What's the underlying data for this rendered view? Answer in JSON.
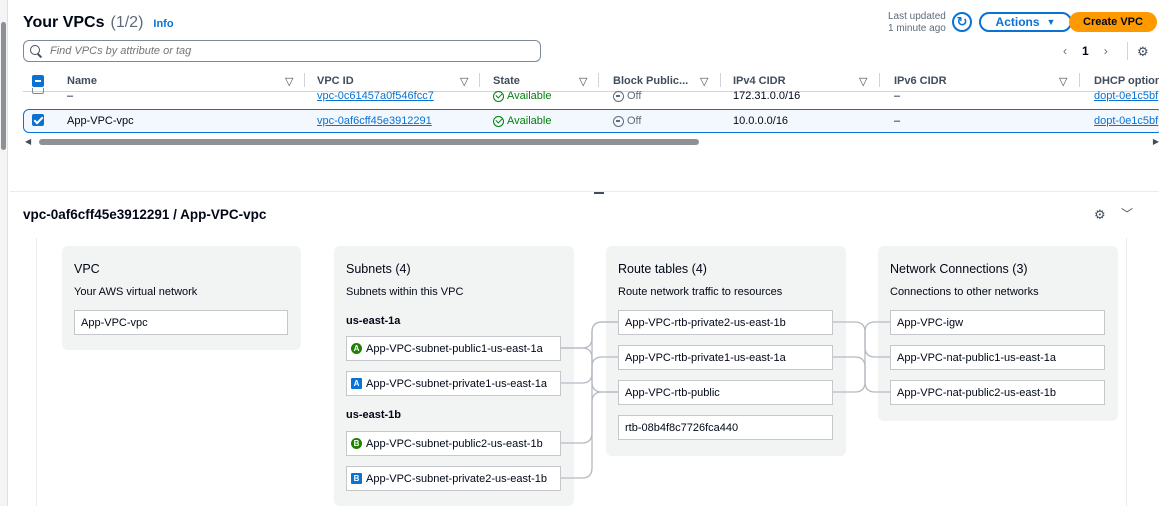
{
  "header": {
    "title": "Your VPCs",
    "count": "(1/2)",
    "info": "Info",
    "last_updated_line1": "Last updated",
    "last_updated_line2": "1 minute ago",
    "actions_label": "Actions",
    "create_label": "Create VPC"
  },
  "search": {
    "placeholder": "Find VPCs by attribute or tag"
  },
  "pagination": {
    "current_page": "1"
  },
  "table": {
    "columns": [
      "Name",
      "VPC ID",
      "State",
      "Block Public...",
      "IPv4 CIDR",
      "IPv6 CIDR",
      "DHCP option"
    ],
    "rows": [
      {
        "name": "–",
        "vpc_id": "vpc-0c61457a0f546fcc7",
        "state": "Available",
        "block_public": "Off",
        "ipv4": "172.31.0.0/16",
        "ipv6": "–",
        "dhcp": "dopt-0e1c5bf",
        "selected": false
      },
      {
        "name": "App-VPC-vpc",
        "vpc_id": "vpc-0af6cff45e3912291",
        "state": "Available",
        "block_public": "Off",
        "ipv4": "10.0.0.0/16",
        "ipv6": "–",
        "dhcp": "dopt-0e1c5bf",
        "selected": true
      }
    ]
  },
  "detail": {
    "title": "vpc-0af6cff45e3912291 / App-VPC-vpc",
    "vpc_card": {
      "title": "VPC",
      "subtitle": "Your AWS virtual network",
      "item": "App-VPC-vpc"
    },
    "subnets_card": {
      "title": "Subnets (4)",
      "subtitle": "Subnets within this VPC",
      "az1": "us-east-1a",
      "az2": "us-east-1b",
      "items": [
        {
          "badge": "A",
          "label": "App-VPC-subnet-public1-us-east-1a"
        },
        {
          "badge": "A",
          "label": "App-VPC-subnet-private1-us-east-1a"
        },
        {
          "badge": "B",
          "label": "App-VPC-subnet-public2-us-east-1b"
        },
        {
          "badge": "B",
          "label": "App-VPC-subnet-private2-us-east-1b"
        }
      ]
    },
    "routes_card": {
      "title": "Route tables (4)",
      "subtitle": "Route network traffic to resources",
      "items": [
        "App-VPC-rtb-private2-us-east-1b",
        "App-VPC-rtb-private1-us-east-1a",
        "App-VPC-rtb-public",
        "rtb-08b4f8c7726fca440"
      ]
    },
    "connections_card": {
      "title": "Network Connections (3)",
      "subtitle": "Connections to other networks",
      "items": [
        "App-VPC-igw",
        "App-VPC-nat-public1-us-east-1a",
        "App-VPC-nat-public2-us-east-1b"
      ]
    }
  }
}
